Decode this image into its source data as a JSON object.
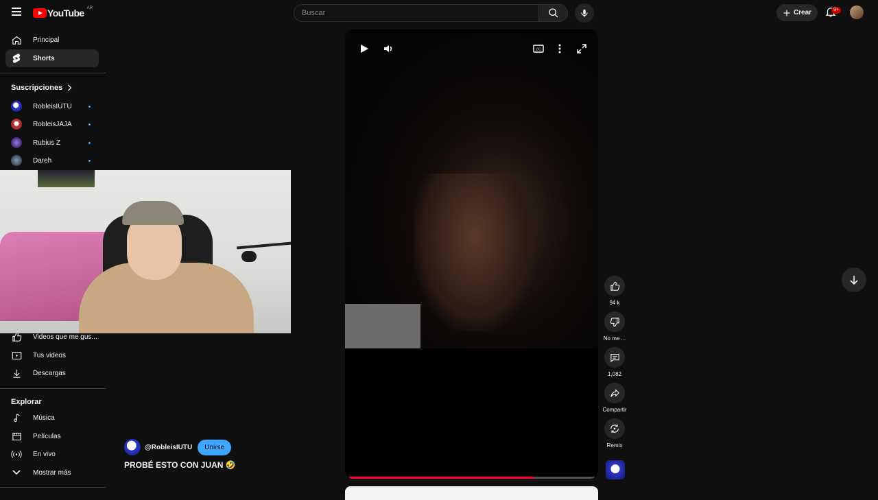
{
  "header": {
    "logo_text": "YouTube",
    "country_code": "AR",
    "search_placeholder": "Buscar",
    "create_label": "Crear",
    "notif_badge": "9+"
  },
  "sidebar": {
    "main": [
      {
        "label": "Principal",
        "icon": "home-icon"
      },
      {
        "label": "Shorts",
        "icon": "shorts-icon",
        "active": true
      }
    ],
    "subscriptions_title": "Suscripciones",
    "subscriptions": [
      {
        "label": "RobleisIUTU"
      },
      {
        "label": "RobleisJAJA"
      },
      {
        "label": "Rubius Z"
      },
      {
        "label": "Dareh"
      }
    ],
    "you": [
      {
        "label": "Videos que me gus...",
        "icon": "like-icon"
      },
      {
        "label": "Tus videos",
        "icon": "video-icon"
      },
      {
        "label": "Descargas",
        "icon": "download-icon"
      }
    ],
    "explore_title": "Explorar",
    "explore": [
      {
        "label": "Música",
        "icon": "music-icon"
      },
      {
        "label": "Películas",
        "icon": "film-icon"
      },
      {
        "label": "En vivo",
        "icon": "live-icon"
      },
      {
        "label": "Mostrar más",
        "icon": "chevron-down-icon"
      }
    ]
  },
  "short": {
    "channel": "@RobleisIUTU",
    "join_label": "Unirse",
    "title": "PROBÉ ESTO CON JUAN 🤣",
    "progress": 0.75
  },
  "actions": {
    "likes": "94 k",
    "dislike_label": "No me ...",
    "comments": "1,082",
    "share_label": "Compartir",
    "remix_label": "Remix"
  },
  "colors": {
    "accent_red": "#ff0000",
    "join_blue": "#3ea6ff",
    "background": "#0f0f0f"
  }
}
